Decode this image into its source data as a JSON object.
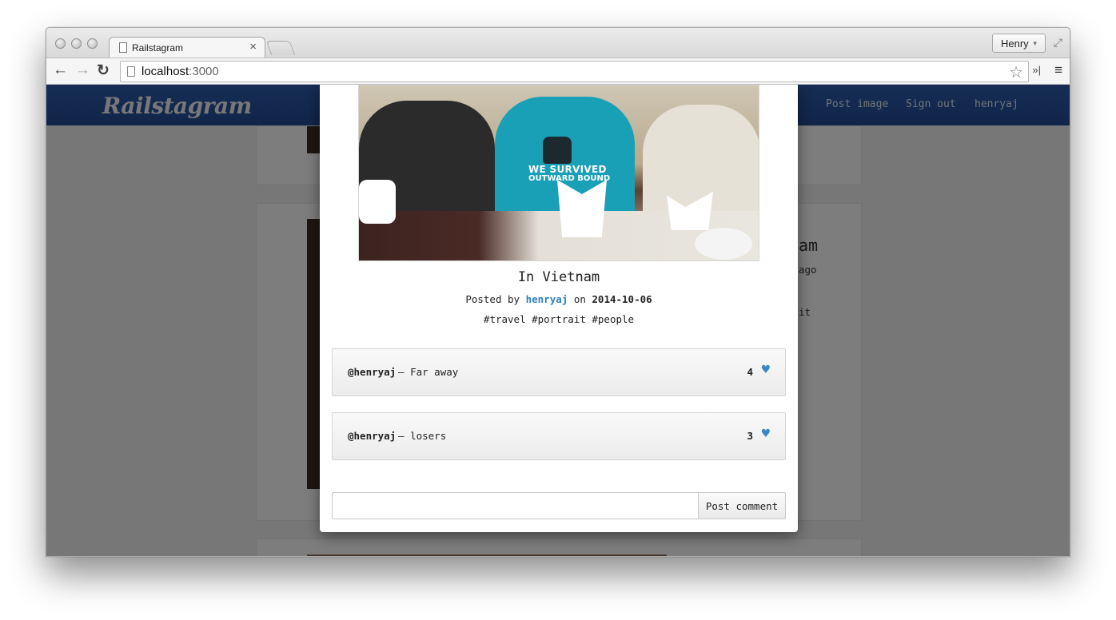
{
  "browser": {
    "tab_title": "Railstagram",
    "tab_close": "×",
    "profile_name": "Henry",
    "url_host": "localhost",
    "url_port": ":3000",
    "icons": {
      "back": "←",
      "forward": "→",
      "reload": "↻",
      "star": "☆",
      "extensions": "»|",
      "menu": "≡",
      "fullscreen": "⤢",
      "caret": "▼"
    }
  },
  "site": {
    "brand": "Railstagram",
    "nav": [
      "Post image",
      "Sign out",
      "henryaj"
    ],
    "accent_color": "#2a56a2"
  },
  "background": {
    "partial_title": "am",
    "partial_time": "ago",
    "partial_link": "it"
  },
  "modal": {
    "photo_shirt_line1": "WE SURVIVED",
    "photo_shirt_line2": "OUTWARD BOUND",
    "caption": "In Vietnam",
    "posted_by_prefix": "Posted by",
    "author": "henryaj",
    "on_text": "on",
    "date": "2014-10-06",
    "tags": "#travel #portrait #people",
    "comments": [
      {
        "user": "@henryaj",
        "separator": "—",
        "text": "Far away",
        "likes": "4"
      },
      {
        "user": "@henryaj",
        "separator": "—",
        "text": "losers",
        "likes": "3"
      }
    ],
    "comment_input_value": "",
    "comment_submit": "Post comment",
    "heart_icon": "♥",
    "heart_color": "#3a86c8"
  }
}
